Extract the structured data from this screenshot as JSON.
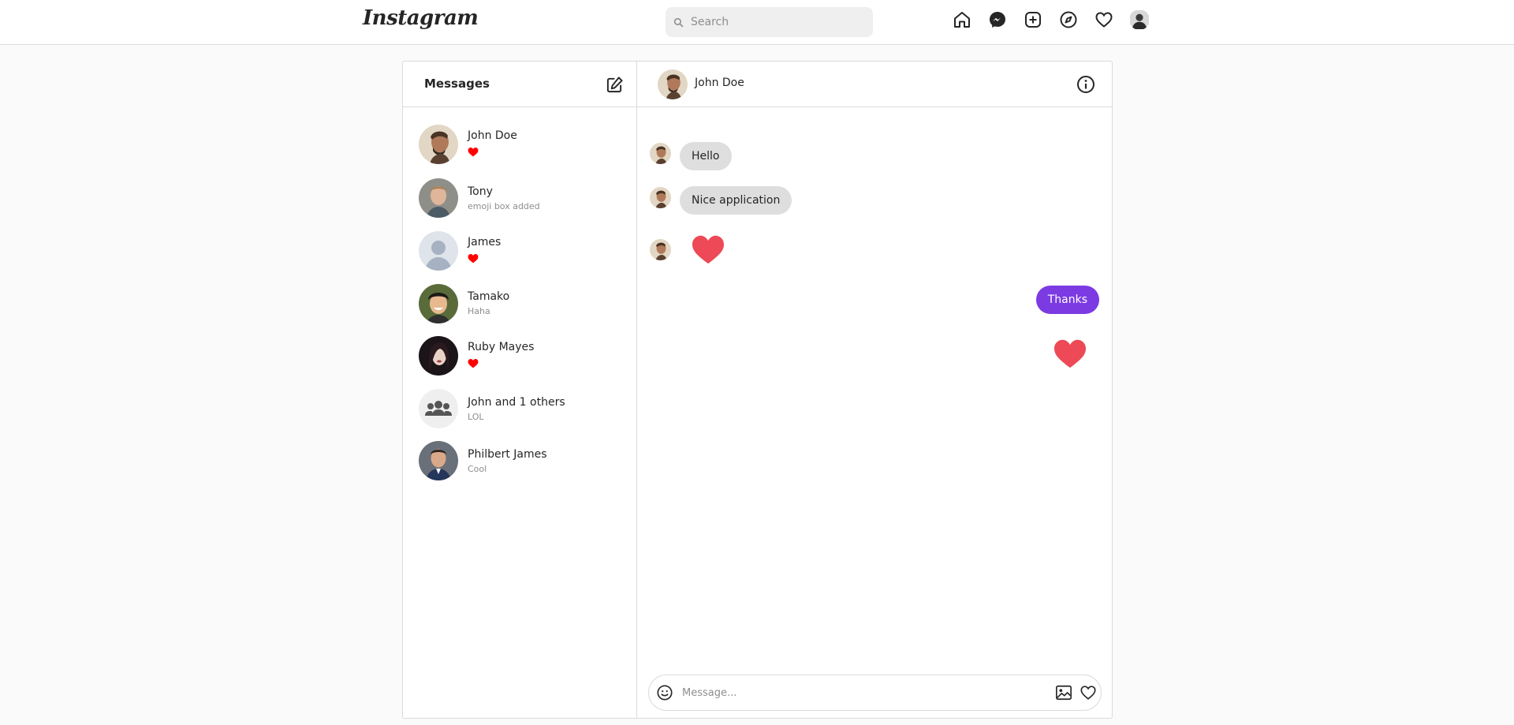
{
  "nav": {
    "logo": "Instagram",
    "search_placeholder": "Search",
    "icons": [
      "home-icon",
      "messenger-icon",
      "new-post-icon",
      "explore-icon",
      "heart-icon",
      "profile-avatar"
    ]
  },
  "sidebar": {
    "title": "Messages",
    "compose_icon": "compose-icon",
    "conversations": [
      {
        "name": "John Doe",
        "preview": "",
        "preview_icon": "heart"
      },
      {
        "name": "Tony",
        "preview": "emoji box added"
      },
      {
        "name": "James",
        "preview": "",
        "preview_icon": "heart"
      },
      {
        "name": "Tamako",
        "preview": "Haha"
      },
      {
        "name": "Ruby Mayes",
        "preview": "",
        "preview_icon": "heart"
      },
      {
        "name": "John and 1 others",
        "preview": "LOL"
      },
      {
        "name": "Philbert James",
        "preview": "Cool"
      }
    ]
  },
  "chat": {
    "header_name": "John Doe",
    "info_icon": "info-icon",
    "messages": [
      {
        "from": "them",
        "type": "text",
        "text": "Hello"
      },
      {
        "from": "them",
        "type": "text",
        "text": "Nice application"
      },
      {
        "from": "them",
        "type": "heart"
      },
      {
        "from": "me",
        "type": "text",
        "text": "Thanks"
      },
      {
        "from": "me",
        "type": "heart"
      }
    ],
    "composer_placeholder": "Message..."
  },
  "colors": {
    "accent": "#7c3ae3",
    "heart_large": "#ed4956",
    "heart_small": "#ff0000",
    "border": "#dbdbdb",
    "background": "#fafafa"
  }
}
